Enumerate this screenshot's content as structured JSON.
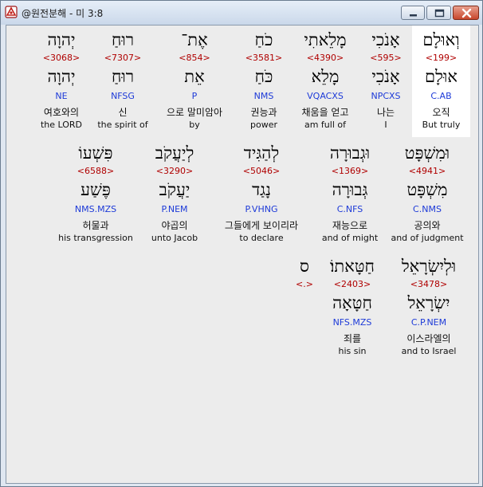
{
  "window": {
    "title": "@원전분해 - 미 3:8",
    "min_icon": "minimize-icon",
    "max_icon": "maximize-icon",
    "close_icon": "close-icon"
  },
  "rows": [
    {
      "words": [
        {
          "heb1": "וְאוּלָם",
          "num": "<199>",
          "heb2": "אוּלָם",
          "gram": "C.AB",
          "kor": "오직",
          "eng": "But truly",
          "selected": true
        },
        {
          "heb1": "אָנֹכִי",
          "num": "<595>",
          "heb2": "אָנֹכִי",
          "gram": "NPCXS",
          "kor": "나는",
          "eng": "I",
          "selected": false
        },
        {
          "heb1": "מָלֵאתִי",
          "num": "<4390>",
          "heb2": "מָלֵא",
          "gram": "VQACXS",
          "kor": "채움을 얻고",
          "eng": "am full of",
          "selected": false
        },
        {
          "heb1": "כֹחַ",
          "num": "<3581>",
          "heb2": "כֹּחַ",
          "gram": "NMS",
          "kor": "권능과",
          "eng": "power",
          "selected": false
        },
        {
          "heb1": "אֶת־",
          "num": "<854>",
          "heb2": "אֵת",
          "gram": "P",
          "kor": "으로 말미암아",
          "eng": "by",
          "selected": false
        },
        {
          "heb1": "רוּחַ",
          "num": "<7307>",
          "heb2": "רוּחַ",
          "gram": "NFSG",
          "kor": "신",
          "eng": "the spirit of",
          "selected": false
        },
        {
          "heb1": "יְהוָה",
          "num": "<3068>",
          "heb2": "יְהוָה",
          "gram": "NE",
          "kor": "여호와의",
          "eng": "the LORD",
          "selected": false
        }
      ]
    },
    {
      "words": [
        {
          "heb1": "וּמִשְׁפָּט",
          "num": "<4941>",
          "heb2": "מִשְׁפָּט",
          "gram": "C.NMS",
          "kor": "공의와",
          "eng": "and of judgment"
        },
        {
          "heb1": "וּגְבוּרָה",
          "num": "<1369>",
          "heb2": "גְּבוּרָה",
          "gram": "C.NFS",
          "kor": "재능으로",
          "eng": "and of might"
        },
        {
          "heb1": "לְהַגִּיד",
          "num": "<5046>",
          "heb2": "נָגַד",
          "gram": "P.VHNG",
          "kor": "그들에게 보이리라",
          "eng": "to declare"
        },
        {
          "heb1": "לְיַעֲקֹב",
          "num": "<3290>",
          "heb2": "יַעֲקֹב",
          "gram": "P.NEM",
          "kor": "야곱의",
          "eng": "unto Jacob"
        },
        {
          "heb1": "פִּשְׁעוֹ",
          "num": "<6588>",
          "heb2": "פֶּשַׁע",
          "gram": "NMS.MZS",
          "kor": "허물과",
          "eng": "his transgression"
        }
      ]
    },
    {
      "words": [
        {
          "heb1": "וּלְיִשְׂרָאֵל",
          "num": "<3478>",
          "heb2": "יִשְׂרָאֵל",
          "gram": "C.P.NEM",
          "kor": "이스라엘의",
          "eng": "and to Israel"
        },
        {
          "heb1": "חַטָּאתוֹ׃",
          "num": "<2403>",
          "heb2": "חַטָּאָה",
          "gram": "NFS.MZS",
          "kor": "죄를",
          "eng": "his sin"
        },
        {
          "heb1": "ס",
          "num": "<.>",
          "heb2": "",
          "gram": "",
          "kor": "",
          "eng": ""
        }
      ]
    }
  ]
}
